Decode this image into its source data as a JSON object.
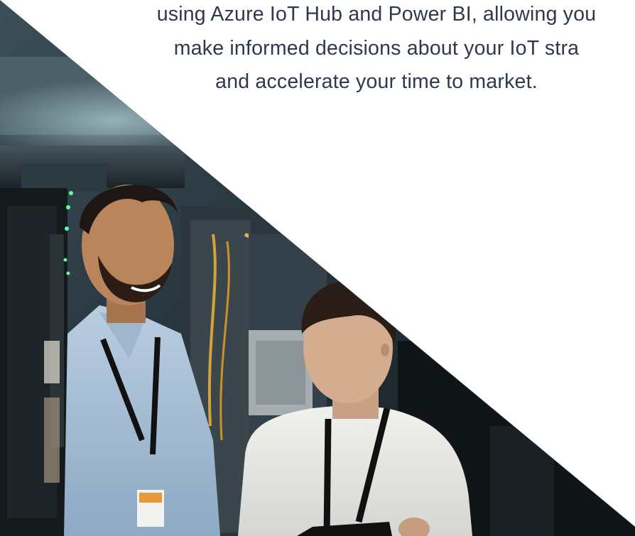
{
  "intro": {
    "lines": [
      "using Azure IoT Hub and Power BI, allowing you",
      "make informed decisions about your IoT stra",
      "and accelerate your time to market."
    ]
  },
  "photo": {
    "subject": "two-people-in-server-room"
  },
  "colors": {
    "text": "#2d3a4d",
    "background": "#ffffff"
  }
}
